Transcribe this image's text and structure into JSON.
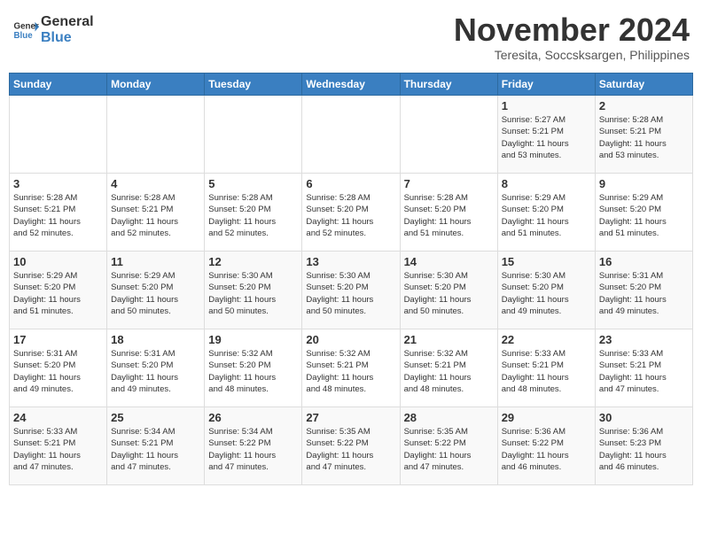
{
  "header": {
    "logo_line1": "General",
    "logo_line2": "Blue",
    "month": "November 2024",
    "location": "Teresita, Soccsksargen, Philippines"
  },
  "days_of_week": [
    "Sunday",
    "Monday",
    "Tuesday",
    "Wednesday",
    "Thursday",
    "Friday",
    "Saturday"
  ],
  "weeks": [
    [
      {
        "day": "",
        "info": ""
      },
      {
        "day": "",
        "info": ""
      },
      {
        "day": "",
        "info": ""
      },
      {
        "day": "",
        "info": ""
      },
      {
        "day": "",
        "info": ""
      },
      {
        "day": "1",
        "info": "Sunrise: 5:27 AM\nSunset: 5:21 PM\nDaylight: 11 hours\nand 53 minutes."
      },
      {
        "day": "2",
        "info": "Sunrise: 5:28 AM\nSunset: 5:21 PM\nDaylight: 11 hours\nand 53 minutes."
      }
    ],
    [
      {
        "day": "3",
        "info": "Sunrise: 5:28 AM\nSunset: 5:21 PM\nDaylight: 11 hours\nand 52 minutes."
      },
      {
        "day": "4",
        "info": "Sunrise: 5:28 AM\nSunset: 5:21 PM\nDaylight: 11 hours\nand 52 minutes."
      },
      {
        "day": "5",
        "info": "Sunrise: 5:28 AM\nSunset: 5:20 PM\nDaylight: 11 hours\nand 52 minutes."
      },
      {
        "day": "6",
        "info": "Sunrise: 5:28 AM\nSunset: 5:20 PM\nDaylight: 11 hours\nand 52 minutes."
      },
      {
        "day": "7",
        "info": "Sunrise: 5:28 AM\nSunset: 5:20 PM\nDaylight: 11 hours\nand 51 minutes."
      },
      {
        "day": "8",
        "info": "Sunrise: 5:29 AM\nSunset: 5:20 PM\nDaylight: 11 hours\nand 51 minutes."
      },
      {
        "day": "9",
        "info": "Sunrise: 5:29 AM\nSunset: 5:20 PM\nDaylight: 11 hours\nand 51 minutes."
      }
    ],
    [
      {
        "day": "10",
        "info": "Sunrise: 5:29 AM\nSunset: 5:20 PM\nDaylight: 11 hours\nand 51 minutes."
      },
      {
        "day": "11",
        "info": "Sunrise: 5:29 AM\nSunset: 5:20 PM\nDaylight: 11 hours\nand 50 minutes."
      },
      {
        "day": "12",
        "info": "Sunrise: 5:30 AM\nSunset: 5:20 PM\nDaylight: 11 hours\nand 50 minutes."
      },
      {
        "day": "13",
        "info": "Sunrise: 5:30 AM\nSunset: 5:20 PM\nDaylight: 11 hours\nand 50 minutes."
      },
      {
        "day": "14",
        "info": "Sunrise: 5:30 AM\nSunset: 5:20 PM\nDaylight: 11 hours\nand 50 minutes."
      },
      {
        "day": "15",
        "info": "Sunrise: 5:30 AM\nSunset: 5:20 PM\nDaylight: 11 hours\nand 49 minutes."
      },
      {
        "day": "16",
        "info": "Sunrise: 5:31 AM\nSunset: 5:20 PM\nDaylight: 11 hours\nand 49 minutes."
      }
    ],
    [
      {
        "day": "17",
        "info": "Sunrise: 5:31 AM\nSunset: 5:20 PM\nDaylight: 11 hours\nand 49 minutes."
      },
      {
        "day": "18",
        "info": "Sunrise: 5:31 AM\nSunset: 5:20 PM\nDaylight: 11 hours\nand 49 minutes."
      },
      {
        "day": "19",
        "info": "Sunrise: 5:32 AM\nSunset: 5:20 PM\nDaylight: 11 hours\nand 48 minutes."
      },
      {
        "day": "20",
        "info": "Sunrise: 5:32 AM\nSunset: 5:21 PM\nDaylight: 11 hours\nand 48 minutes."
      },
      {
        "day": "21",
        "info": "Sunrise: 5:32 AM\nSunset: 5:21 PM\nDaylight: 11 hours\nand 48 minutes."
      },
      {
        "day": "22",
        "info": "Sunrise: 5:33 AM\nSunset: 5:21 PM\nDaylight: 11 hours\nand 48 minutes."
      },
      {
        "day": "23",
        "info": "Sunrise: 5:33 AM\nSunset: 5:21 PM\nDaylight: 11 hours\nand 47 minutes."
      }
    ],
    [
      {
        "day": "24",
        "info": "Sunrise: 5:33 AM\nSunset: 5:21 PM\nDaylight: 11 hours\nand 47 minutes."
      },
      {
        "day": "25",
        "info": "Sunrise: 5:34 AM\nSunset: 5:21 PM\nDaylight: 11 hours\nand 47 minutes."
      },
      {
        "day": "26",
        "info": "Sunrise: 5:34 AM\nSunset: 5:22 PM\nDaylight: 11 hours\nand 47 minutes."
      },
      {
        "day": "27",
        "info": "Sunrise: 5:35 AM\nSunset: 5:22 PM\nDaylight: 11 hours\nand 47 minutes."
      },
      {
        "day": "28",
        "info": "Sunrise: 5:35 AM\nSunset: 5:22 PM\nDaylight: 11 hours\nand 47 minutes."
      },
      {
        "day": "29",
        "info": "Sunrise: 5:36 AM\nSunset: 5:22 PM\nDaylight: 11 hours\nand 46 minutes."
      },
      {
        "day": "30",
        "info": "Sunrise: 5:36 AM\nSunset: 5:23 PM\nDaylight: 11 hours\nand 46 minutes."
      }
    ]
  ]
}
